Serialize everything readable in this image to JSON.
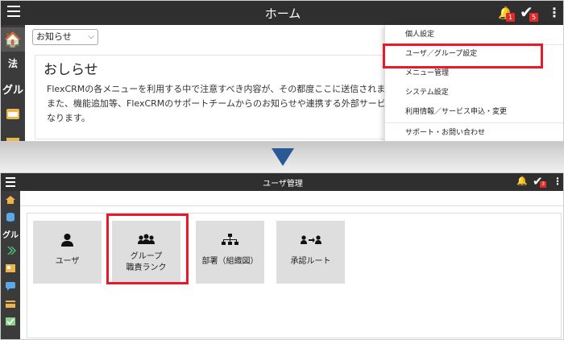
{
  "top": {
    "app_title": "ホーム",
    "notification_count": "1",
    "task_count": "5",
    "sidebar": {
      "item_hou": "法",
      "item_gru": "グル"
    },
    "filter_select": {
      "value": "お知らせ"
    },
    "notice": {
      "title": "おしらせ",
      "lines": [
        "FlexCRMの各メニューを利用する中で注意すべき内容が、その都度ここに送信されま",
        "また、機能追加等、FlexCRMのサポートチームからのお知らせや連携する外部サービ",
        "なります。"
      ]
    },
    "menu": {
      "items": [
        "個人設定",
        "ユーザ／グループ設定",
        "メニュー管理",
        "システム設定",
        "利用情報／サービス申込・変更",
        "サポート・お問い合わせ"
      ],
      "highlighted": "ユーザ／グループ設定"
    }
  },
  "bottom": {
    "app_title": "ユーザ管理",
    "task_count": "3",
    "sidebar": {
      "item_gru": "グル"
    },
    "tiles": [
      {
        "label": "ユーザ",
        "icon": "person-icon"
      },
      {
        "label": "グループ",
        "label2": "職責ランク",
        "icon": "group-icon",
        "highlighted": true
      },
      {
        "label": "部署（組織図）",
        "icon": "org-chart-icon"
      },
      {
        "label": "承認ルート",
        "icon": "approval-route-icon"
      }
    ]
  },
  "colors": {
    "header_bg": "#2f2f2f",
    "sidebar_bg": "#3b3b3b",
    "highlight_red": "#e8192b",
    "arrow_blue": "#2a5a96",
    "tile_bg": "#dedede",
    "badge_red": "#e12a2a"
  }
}
